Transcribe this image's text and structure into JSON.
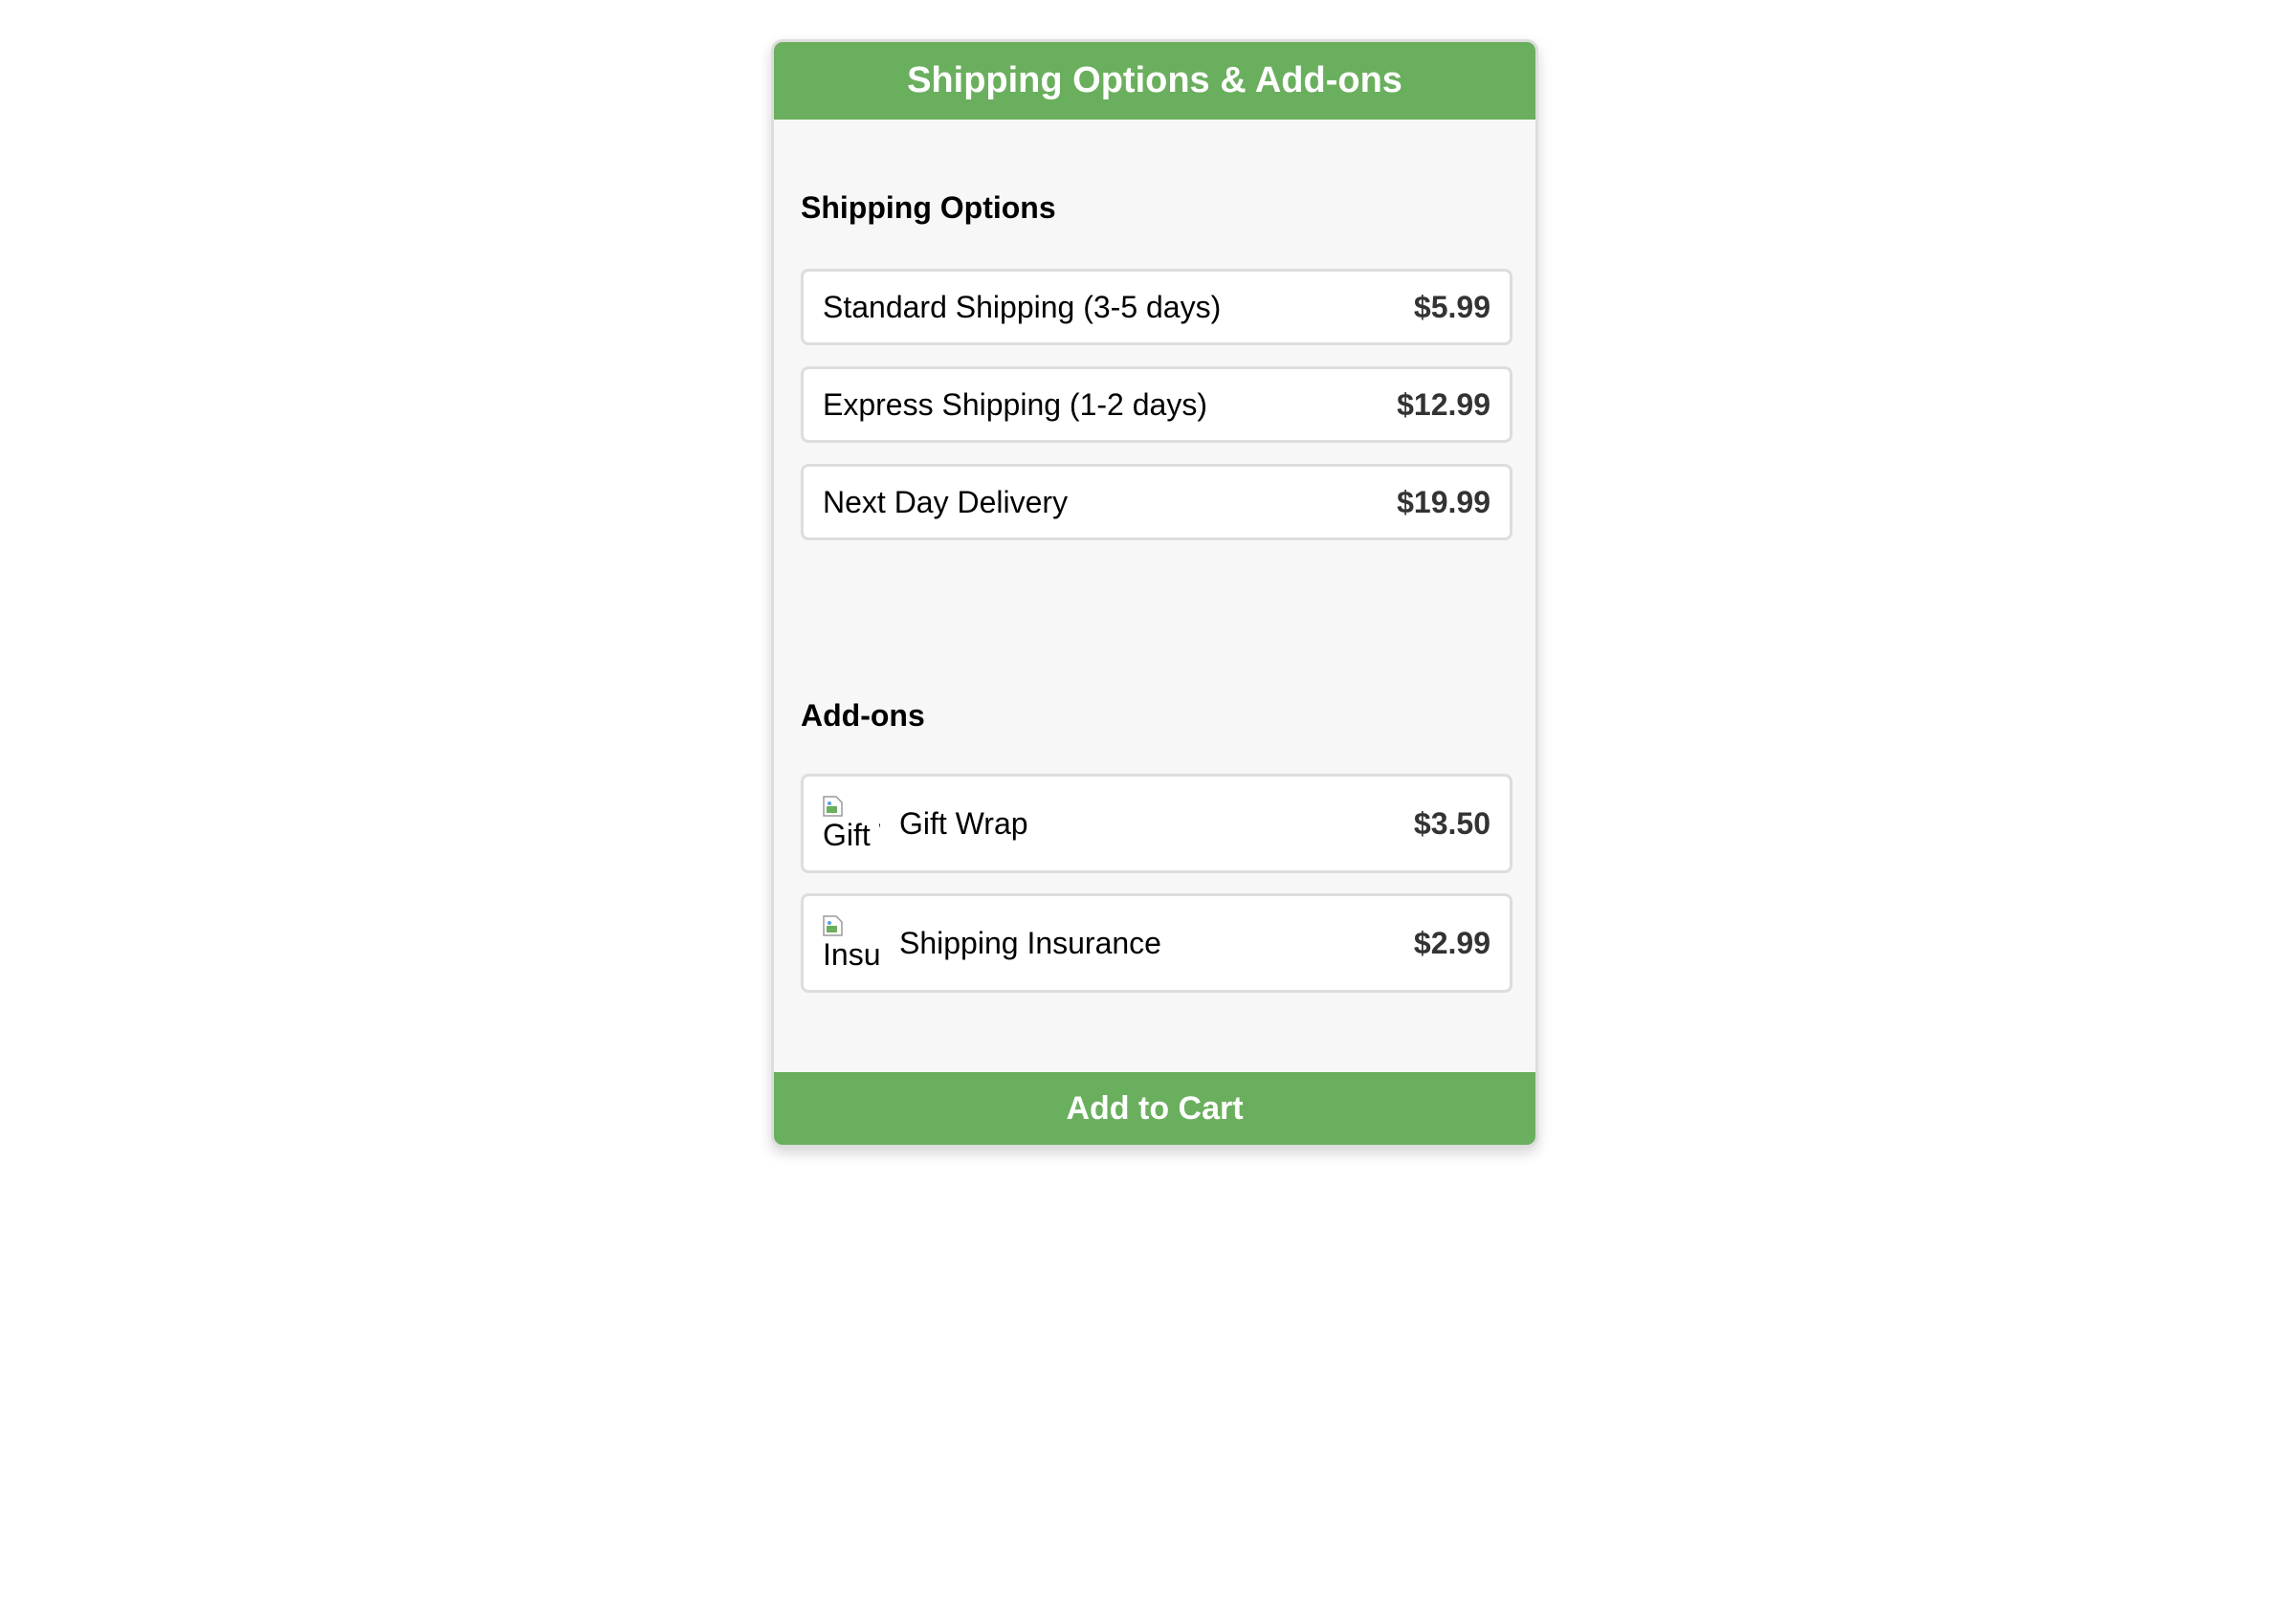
{
  "header": {
    "title": "Shipping Options & Add-ons"
  },
  "shipping": {
    "title": "Shipping Options",
    "options": [
      {
        "label": "Standard Shipping (3-5 days)",
        "price": "$5.99"
      },
      {
        "label": "Express Shipping (1-2 days)",
        "price": "$12.99"
      },
      {
        "label": "Next Day Delivery",
        "price": "$19.99"
      }
    ]
  },
  "addons": {
    "title": "Add-ons",
    "items": [
      {
        "label": "Gift Wrap",
        "price": "$3.50",
        "image_alt": "Gift Wrap"
      },
      {
        "label": "Shipping Insurance",
        "price": "$2.99",
        "image_alt": "Insurance"
      }
    ]
  },
  "cart": {
    "button_label": "Add to Cart"
  },
  "colors": {
    "accent": "#6aaf5d",
    "panel_bg": "#f7f7f7",
    "border": "#dddddd",
    "price_text": "#333333"
  }
}
